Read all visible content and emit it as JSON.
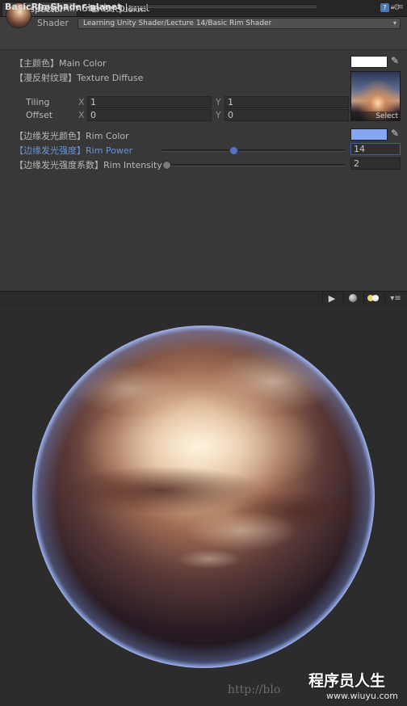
{
  "tabs": [
    {
      "label": "Inspector",
      "icon": "info-icon",
      "active": true
    },
    {
      "label": "Occlusion",
      "icon": "occlusion-icon",
      "active": false
    }
  ],
  "material": {
    "name": "BasicRimShader-planet",
    "shader_label": "Shader",
    "shader_value": "Learning Unity Shader/Lecture 14/Basic Rim Shader"
  },
  "properties": {
    "main_color": {
      "label": "【主颜色】Main Color",
      "color": "#ffffff"
    },
    "texture": {
      "label": "【漫反射纹理】Texture Diffuse",
      "tiling_label": "Tiling",
      "offset_label": "Offset",
      "tiling_x": "1",
      "tiling_y": "1",
      "offset_x": "0",
      "offset_y": "0",
      "select_label": "Select"
    },
    "rim_color": {
      "label": "【边缘发光颜色】Rim Color",
      "color": "#86a6f0"
    },
    "rim_power": {
      "label": "【边缘发光强度】Rim Power",
      "value": "14",
      "fraction": 0.39
    },
    "rim_intensity": {
      "label": "【边缘发光强度系数】Rim Intensity",
      "value": "2",
      "fraction": 0.0
    }
  },
  "axis": {
    "x": "X",
    "y": "Y"
  },
  "preview": {
    "title": "BasicRimShader-planet"
  },
  "watermark": {
    "text": "程序员人生",
    "url": "http://blo",
    "site": "www.wiuyu.com"
  },
  "colors": {
    "highlight_label": "#6c93d6",
    "rim": "#86a6f0",
    "background": "#383838"
  }
}
